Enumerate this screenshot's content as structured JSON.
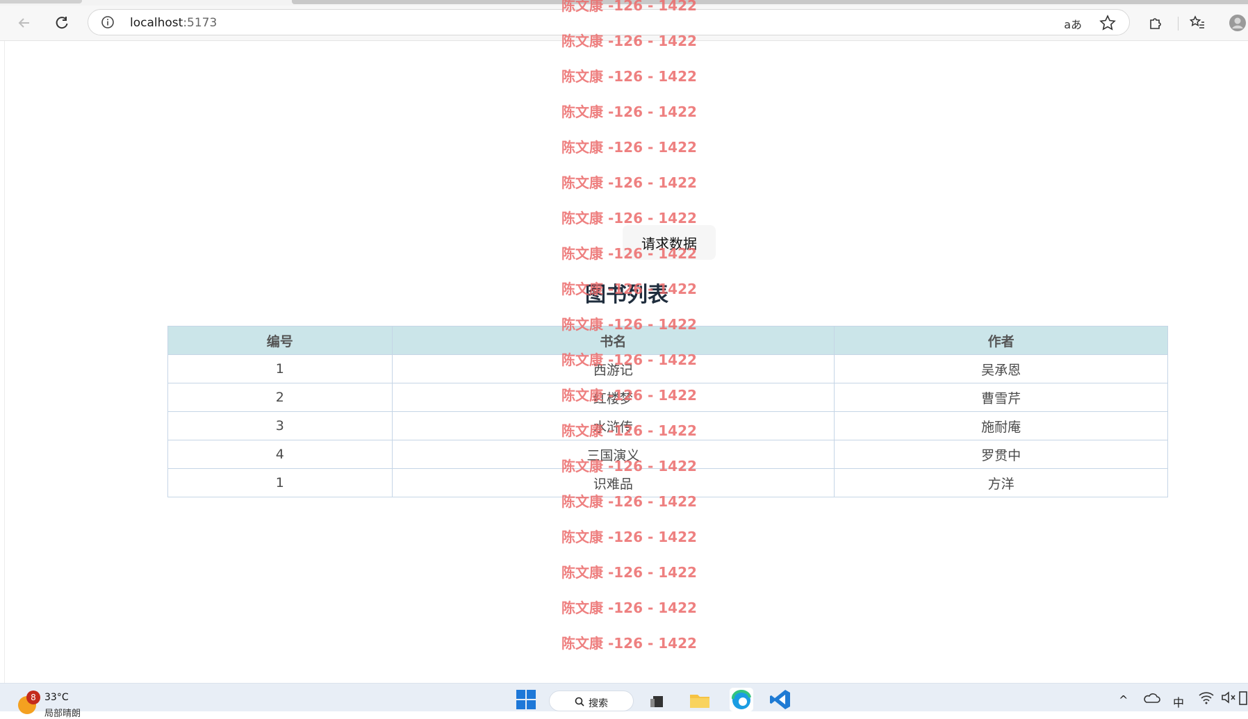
{
  "browser": {
    "url_host": "localhost",
    "url_port": ":5173",
    "read_aloud_label": "aあ"
  },
  "page": {
    "request_button": "请求数据",
    "title": "图书列表",
    "table": {
      "headers": [
        "编号",
        "书名",
        "作者"
      ],
      "rows": [
        [
          "1",
          "西游记",
          "吴承恩"
        ],
        [
          "2",
          "红楼梦",
          "曹雪芹"
        ],
        [
          "3",
          "水浒传",
          "施耐庵"
        ],
        [
          "4",
          "三国演义",
          "罗贯中"
        ],
        [
          "1",
          "识难品",
          "方洋"
        ]
      ]
    }
  },
  "watermark": {
    "text": "陈文康 -126 - 1422",
    "color": "#ec6b6b"
  },
  "taskbar": {
    "weather_badge": "8",
    "temperature": "33°C",
    "weather_desc": "局部晴朗",
    "search_label": "搜索",
    "ime_label": "中"
  }
}
